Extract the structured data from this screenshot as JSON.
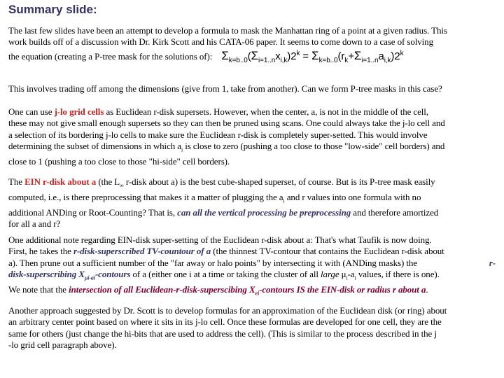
{
  "title": "Summary slide:",
  "p1": {
    "line1": "The last few slides have been an attempt to develop a formula to mask the Manhattan ring of a point at a given radius.  This",
    "line2": "work builds off of a discussion with Dr. Kirk Scott and his CATA-06 paper.  It seems to come down to a case of solving",
    "line3": "the equation (creating a P-tree mask for the solutions of):",
    "eq": {
      "sigma": "Σ",
      "k_range": "k=b..0",
      "open": "(",
      "i_range": "i=1..n",
      "x": "x",
      "xi": "i,k",
      "close": ")",
      "two": "2",
      "k": "k",
      "equals": " = ",
      "r": "(r",
      "rk": "k",
      "plus": "+",
      "a": "a",
      "ai": "i,k"
    }
  },
  "p2": "This involves trading off among the dimensions (give from 1, take from another). Can we form P-tree masks in this case?",
  "p3": {
    "pre": "One can use ",
    "highlight": "j-lo grid cells",
    "l1": " as Euclidean r-disk supersets.  However, when the center, a, is not in the middle of the cell,",
    "l2": "these may not give small enough supersets so they can then be pruned using scans.  One could always take the j-lo cell and",
    "l3": "a selection of its bordering j-lo cells to make sure the Euclidean r-disk is completely super-setted.  This would involve",
    "l4a": "determining the subset of dimensions in which a",
    "l4sub": "i",
    "l4b": " is close to zero (pushing a too close to those \"low-side\" cell borders) and",
    "l5": "close to 1 (pushing a too close to those \"hi-side\" cell borders)."
  },
  "p4": {
    "pre": "The ",
    "highlight": "EIN r-disk about a",
    "l1a": " (the L",
    "inf": "∞",
    "l1b": " r-disk about a) is the best cube-shaped superset, of course.  But is its P-tree mask easily",
    "l2a": "computed, i.e., is there preprocessing that makes it a matter of plugging the a",
    "l2sub": "i",
    "l2b": " and r values into one formula with no",
    "l3a": "additional ANDing or Root-Counting?  That is, ",
    "l3em": "can all the vertical processing be preprocessing",
    "l3b": " and therefore amortized",
    "l4": "for all a and r?"
  },
  "p5": {
    "l1": "One additional note regarding EIN-disk super-setting of the Euclidean r-disk about a:  That's what Taufik is now doing.",
    "l2a": "First, he takes the ",
    "l2em": "r-disk-superscribed TV-countour of a",
    "l2b": "  (the thinnest TV-contour that contains the Euclidean r-disk about",
    "l3a": "a).  Then prune out a sufficient number of the \"far away or halo points\" by intersecting it with (ANDing masks) the",
    "l3em": "r-",
    "l4em1": "disk-superscribing X",
    "l4sub": "μi-ai",
    "l4em2": "-contours",
    "l4b": " of a (either one i at a time or taking the cluster of all ",
    "l4it": "large",
    "l4c": " μ",
    "l4sub2": "i",
    "l4d": "-a",
    "l4sub3": "i",
    "l4e": " values, if there is one).",
    "l5a": "We note that the ",
    "l5em1": "intersection of all Euclidean-r-disk-superscibing X",
    "l5sub": "ei",
    "l5em2": "-contours IS the EIN-disk or radius r about a",
    "l5b": "."
  },
  "p6": {
    "l1": "Another approach suggested by Dr. Scott is to develop formulas for an approximation of the Euclidean disk (or ring) about",
    "l2": "an arbitrary center point based on where it sits in its j-lo cell.  Once these formulas are developed for one cell, they are the",
    "l3": "same for others (just change the hi-bits that are used to address the cell).     (This is similar to the process described in the j",
    "l4": "-lo grid cell paragraph above)."
  }
}
